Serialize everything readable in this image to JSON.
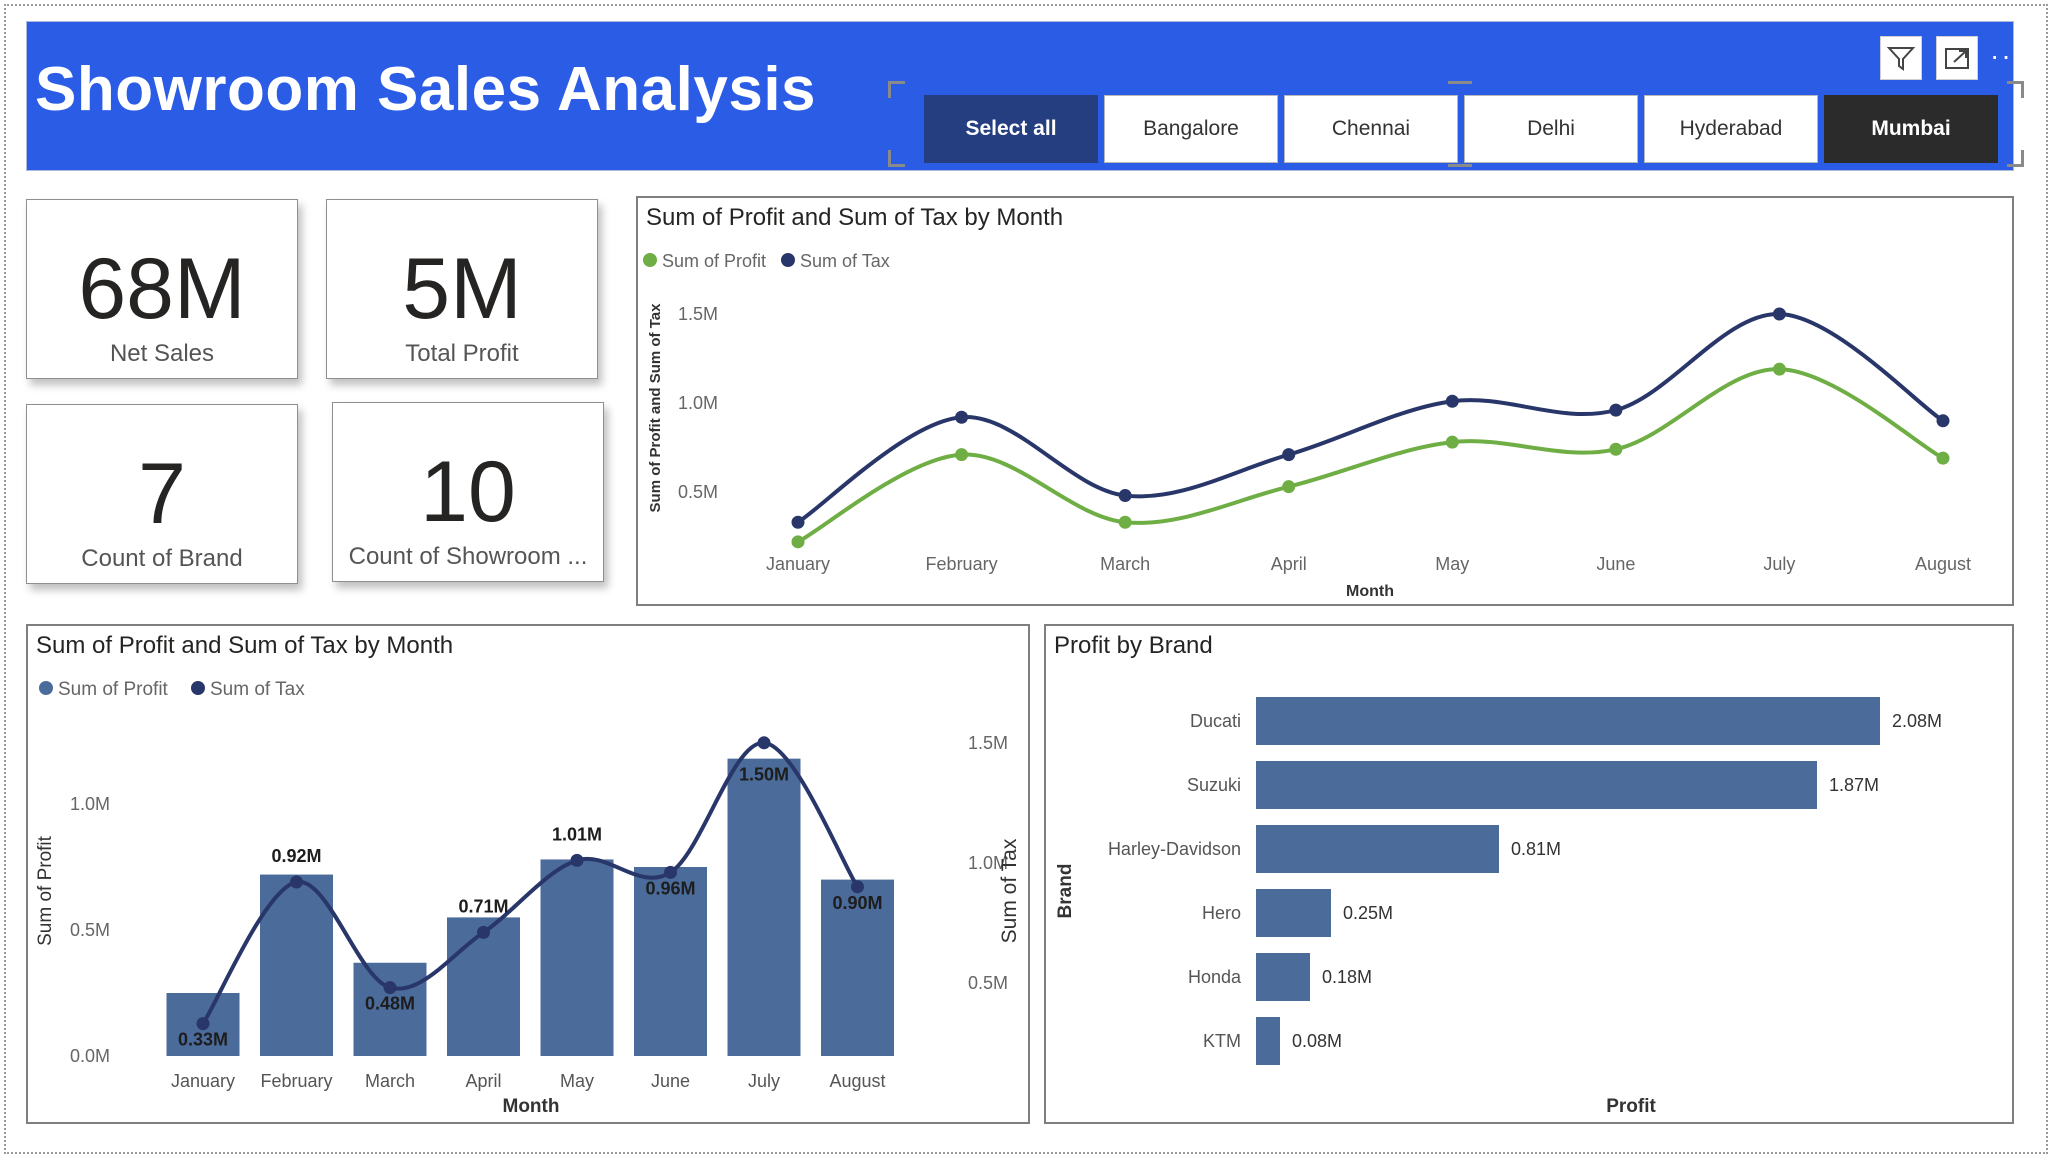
{
  "header": {
    "title": "Showroom Sales Analysis",
    "bg_color": "#2b5ce6"
  },
  "slicer": {
    "options": [
      "Select all",
      "Bangalore",
      "Chennai",
      "Delhi",
      "Hyderabad",
      "Mumbai"
    ],
    "selected": "Mumbai"
  },
  "toolbar": {
    "icons": [
      "filter-icon",
      "focus-mode-icon"
    ],
    "more": "···"
  },
  "kpis": [
    {
      "value": "68M",
      "label": "Net Sales"
    },
    {
      "value": "5M",
      "label": "Total Profit"
    },
    {
      "value": "7",
      "label": "Count of Brand"
    },
    {
      "value": "10",
      "label": "Count of Showroom ..."
    }
  ],
  "chart_data": [
    {
      "type": "line",
      "title": "Sum of Profit and Sum of Tax by Month",
      "xlabel": "Month",
      "ylabel": "Sum of Profit and Sum of Tax",
      "categories": [
        "January",
        "February",
        "March",
        "April",
        "May",
        "June",
        "July",
        "August"
      ],
      "series": [
        {
          "name": "Sum of Profit",
          "color": "#6fae44",
          "values": [
            0.22,
            0.71,
            0.33,
            0.53,
            0.78,
            0.74,
            1.19,
            0.69
          ]
        },
        {
          "name": "Sum of Tax",
          "color": "#293669",
          "values": [
            0.33,
            0.92,
            0.48,
            0.71,
            1.01,
            0.96,
            1.5,
            0.9
          ]
        }
      ],
      "yticks": [
        "0.5M",
        "1.0M",
        "1.5M"
      ],
      "ytick_values": [
        0.5,
        1.0,
        1.5
      ],
      "ylim": [
        0.12,
        1.7
      ],
      "legend": "top-left",
      "grid": false
    },
    {
      "type": "bar",
      "title": "Sum of Profit and Sum of Tax by Month",
      "xlabel": "Month",
      "ylabel": "Sum of Profit",
      "y2label": "Sum of Tax",
      "categories": [
        "January",
        "February",
        "March",
        "April",
        "May",
        "June",
        "July",
        "August"
      ],
      "series": [
        {
          "name": "Sum of Profit",
          "color": "#4b6b9b",
          "values": [
            0.25,
            0.72,
            0.37,
            0.55,
            0.78,
            0.75,
            1.18,
            0.7
          ]
        },
        {
          "name": "Sum of Tax",
          "color": "#293669",
          "values": [
            0.33,
            0.92,
            0.48,
            0.71,
            1.01,
            0.96,
            1.5,
            0.9
          ],
          "labels": [
            "0.33M",
            "0.92M",
            "0.48M",
            "0.71M",
            "1.01M",
            "0.96M",
            "1.50M",
            "0.90M"
          ]
        }
      ],
      "yticks": [
        "0.0M",
        "0.5M",
        "1.0M"
      ],
      "ytick_values": [
        0,
        0.5,
        1.0
      ],
      "ylim": [
        0,
        1.5
      ],
      "y2ticks": [
        "0.5M",
        "1.0M",
        "1.5M"
      ],
      "y2tick_values": [
        0.5,
        1.0,
        1.5
      ],
      "y2lim": [
        0.12,
        1.6
      ],
      "legend": "top-left"
    },
    {
      "type": "bar",
      "orientation": "horizontal",
      "title": "Profit by Brand",
      "xlabel": "Profit",
      "ylabel": "Brand",
      "categories": [
        "Ducati",
        "Suzuki",
        "Harley-Davidson",
        "Hero",
        "Honda",
        "KTM"
      ],
      "values": [
        2.08,
        1.87,
        0.81,
        0.25,
        0.18,
        0.08
      ],
      "labels": [
        "2.08M",
        "1.87M",
        "0.81M",
        "0.25M",
        "0.18M",
        "0.08M"
      ],
      "color": "#4b6b9b",
      "xlim": [
        0,
        2.5
      ]
    }
  ]
}
